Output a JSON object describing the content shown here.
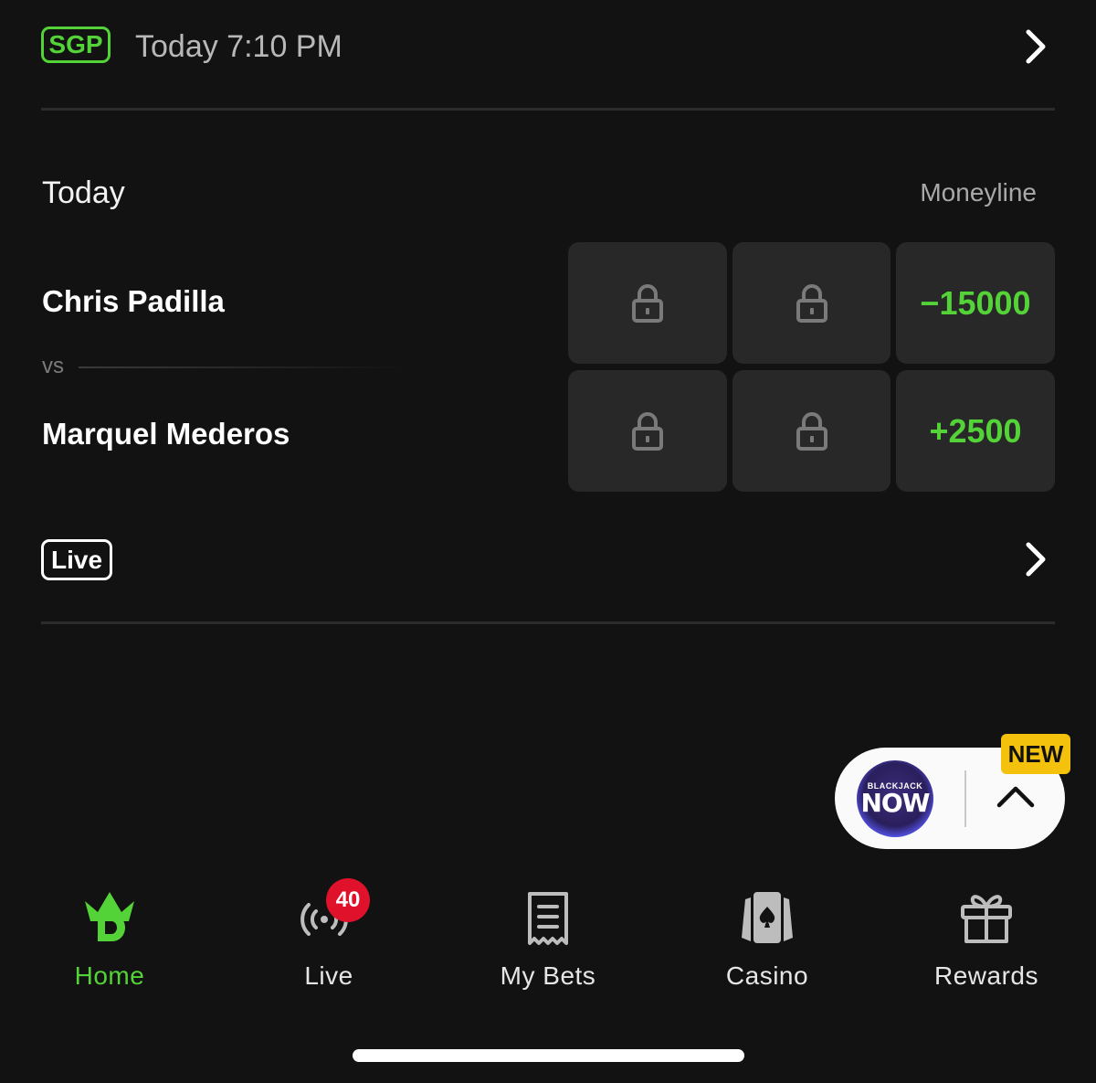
{
  "event": {
    "badge": "SGP",
    "time": "Today 7:10 PM"
  },
  "market": {
    "section_title": "Today",
    "column_header": "Moneyline",
    "team_a": "Chris Padilla",
    "vs": "vs",
    "team_b": "Marquel Mederos",
    "team_a_odds": "−15000",
    "team_b_odds": "+2500"
  },
  "live_badge": "Live",
  "widget": {
    "new_badge": "NEW",
    "logo_small": "BLACKJACK",
    "logo_big": "NOW"
  },
  "nav": {
    "home": "Home",
    "live": "Live",
    "live_count": "40",
    "my_bets": "My Bets",
    "casino": "Casino",
    "rewards": "Rewards"
  },
  "colors": {
    "accent": "#53d337",
    "background": "#121213",
    "cell": "#282829",
    "badge_red": "#e0112b",
    "new_yellow": "#f4c20d"
  },
  "icons": [
    "chevron-right-icon",
    "lock-icon",
    "chevron-up-icon",
    "home-crown-icon",
    "live-broadcast-icon",
    "receipt-icon",
    "casino-cards-icon",
    "gift-icon"
  ]
}
